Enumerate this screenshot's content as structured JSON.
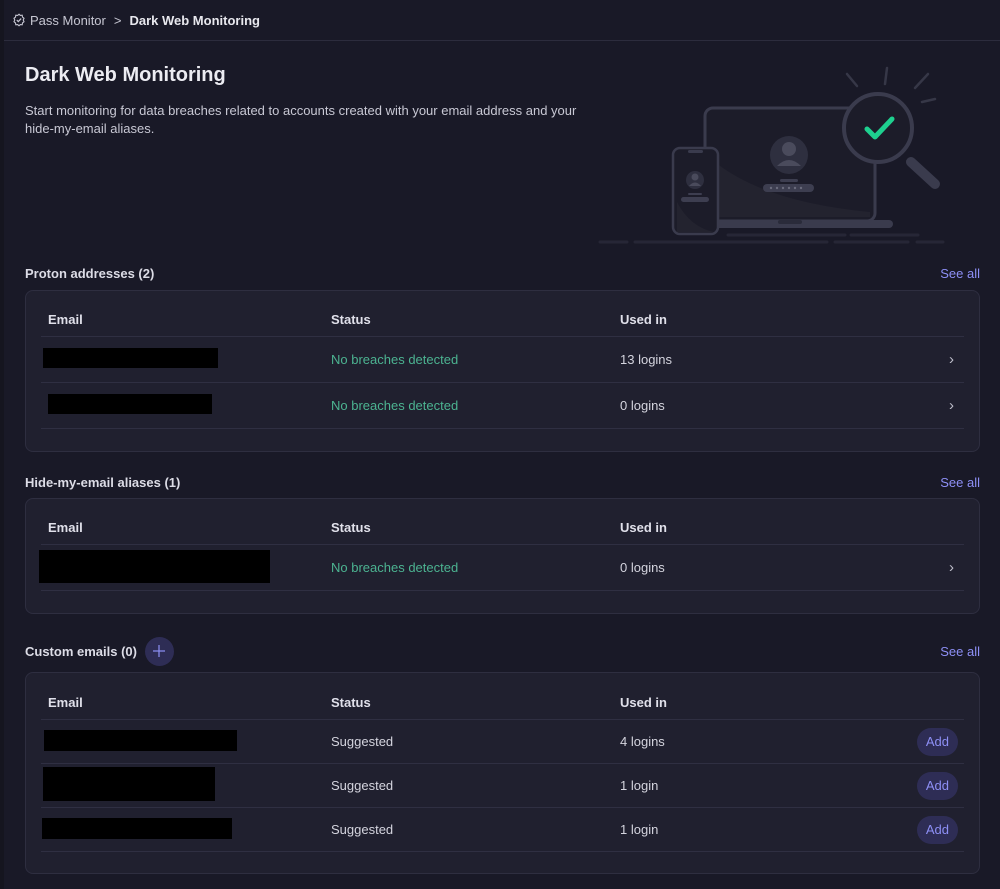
{
  "breadcrumb": {
    "icon": "shield-check-icon",
    "parent": "Pass Monitor",
    "separator": ">",
    "current": "Dark Web Monitoring"
  },
  "header": {
    "title": "Dark Web Monitoring",
    "description": "Start monitoring for data breaches related to accounts created with your email address and your hide-my-email aliases."
  },
  "illustration": {
    "semantic": "devices-magnifier-check-illustration",
    "accent_color": "#1ed08f"
  },
  "columns": {
    "email": "Email",
    "status": "Status",
    "used_in": "Used in"
  },
  "sections": [
    {
      "title": "Proton addresses (2)",
      "see_all": "See all",
      "rows": [
        {
          "email": "[redacted]",
          "status": "No breaches detected",
          "used_in": "13 logins",
          "action": "chevron-right"
        },
        {
          "email": "[redacted]",
          "status": "No breaches detected",
          "used_in": "0 logins",
          "action": "chevron-right"
        }
      ]
    },
    {
      "title": "Hide-my-email aliases (1)",
      "see_all": "See all",
      "rows": [
        {
          "email": "[redacted]",
          "status": "No breaches detected",
          "used_in": "0 logins",
          "action": "chevron-right"
        }
      ]
    },
    {
      "title": "Custom emails (0)",
      "see_all": "See all",
      "add_icon": "plus-icon",
      "rows": [
        {
          "email": "[redacted]",
          "status": "Suggested",
          "used_in": "4 logins",
          "action": "Add"
        },
        {
          "email": "[redacted]",
          "status": "Suggested",
          "used_in": "1 login",
          "action": "Add"
        },
        {
          "email": "[redacted]",
          "status": "Suggested",
          "used_in": "1 login",
          "action": "Add"
        }
      ]
    }
  ],
  "colors": {
    "background": "#191927",
    "card": "#20202f",
    "accent": "#8d8ff5",
    "success": "#4cb391"
  }
}
